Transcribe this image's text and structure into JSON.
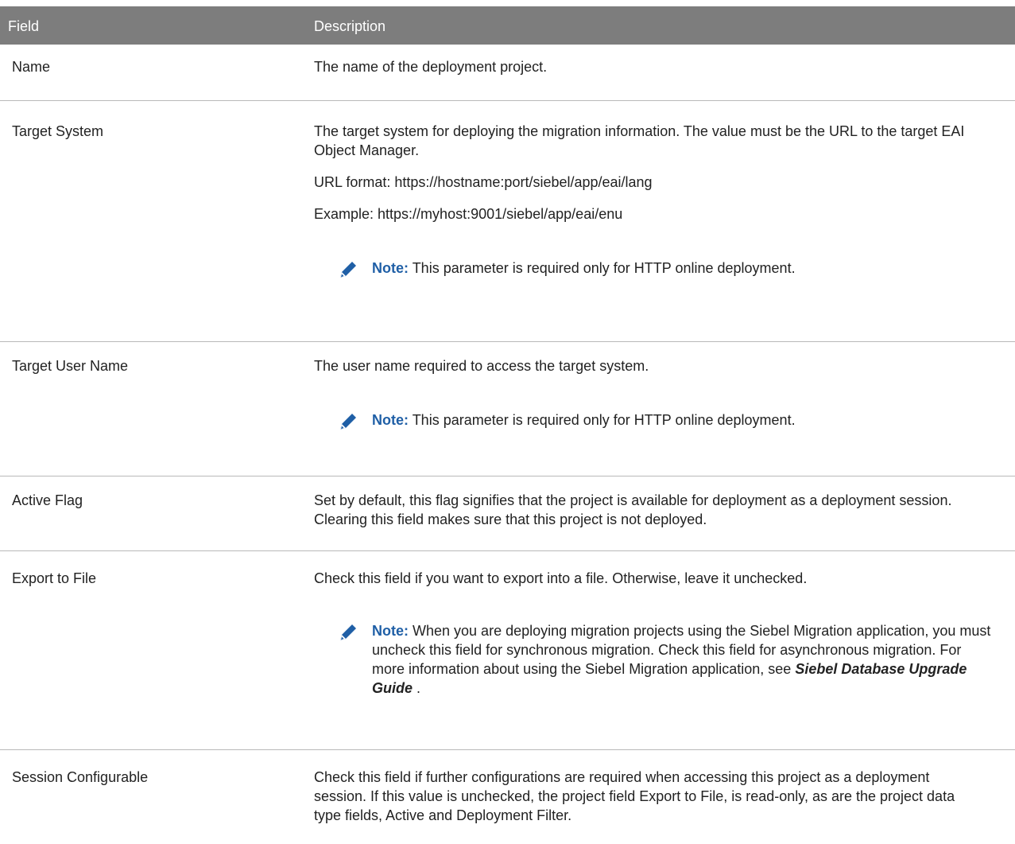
{
  "header": {
    "field": "Field",
    "description": "Description"
  },
  "rows": [
    {
      "field": "Name",
      "desc": [
        "The name of the deployment project."
      ]
    },
    {
      "field": "Target System",
      "desc": [
        "The target system for deploying the migration information. The value must be the URL to the target EAI Object Manager.",
        "URL format: https://hostname:port/siebel/app/eai/lang",
        "Example: https://myhost:9001/siebel/app/eai/enu"
      ],
      "note_label": "Note:",
      "note": "This parameter is required only for HTTP online deployment."
    },
    {
      "field": "Target User Name",
      "desc": [
        "The user name required to access the target system."
      ],
      "note_label": "Note:",
      "note": "This parameter is required only for HTTP online deployment."
    },
    {
      "field": "Active Flag",
      "desc": [
        "Set by default, this flag signifies that the project is available for deployment as a deployment session. Clearing this field makes sure that this project is not deployed."
      ]
    },
    {
      "field": "Export to File",
      "desc": [
        "Check this field if you want to export into a file. Otherwise, leave it unchecked."
      ],
      "note_label": "Note:",
      "note": "When you are deploying migration projects using the Siebel Migration application, you must uncheck this field for synchronous migration. Check this field for asynchronous migration. For more information about using the Siebel Migration application, see ",
      "note_ref": "Siebel Database Upgrade Guide",
      "note_end": " ."
    },
    {
      "field": "Session Configurable",
      "desc": [
        "Check this field if further configurations are required when accessing this project as a deployment session. If this value is unchecked, the project field Export to File, is read-only, as are the project data type fields, Active and Deployment Filter."
      ]
    }
  ],
  "icons": {
    "note": "pencil-icon"
  },
  "colors": {
    "header_bg": "#7d7d7d",
    "note_label": "#1f5fa6",
    "divider": "#b9b9b9"
  }
}
